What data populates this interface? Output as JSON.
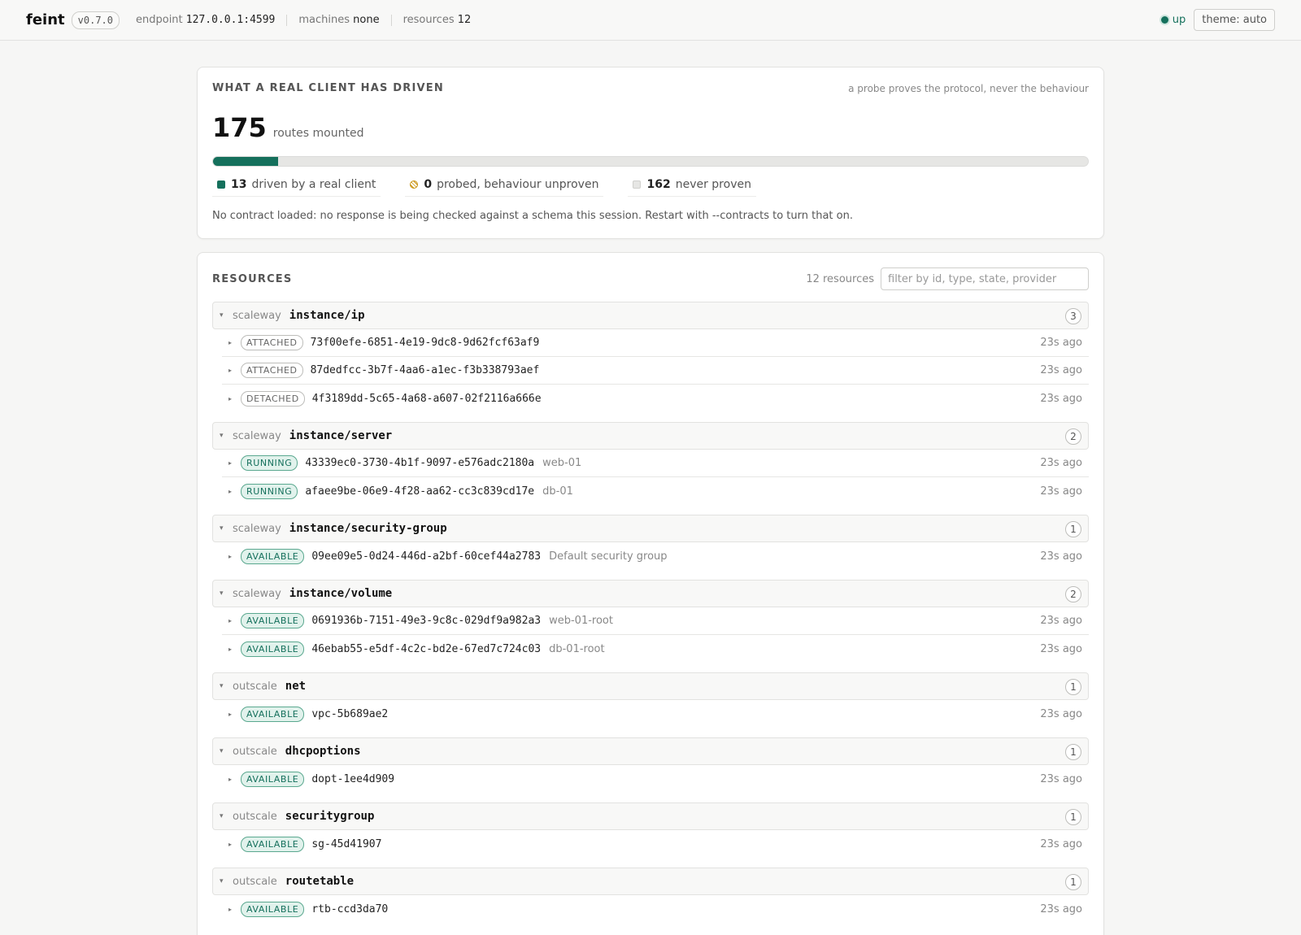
{
  "header": {
    "brand": "feint",
    "version": "v0.7.0",
    "endpoint_label": "endpoint",
    "endpoint_value": "127.0.0.1:4599",
    "machines_label": "machines",
    "machines_value": "none",
    "resources_label": "resources",
    "resources_value": "12",
    "status": "up",
    "theme_label": "theme: auto",
    "status_color": "#15705c"
  },
  "coverage": {
    "title": "WHAT A REAL CLIENT HAS DRIVEN",
    "note": "a probe proves the protocol, never the behaviour",
    "routes": 175,
    "routes_label": "routes mounted",
    "driven": 13,
    "driven_label": "driven by a real client",
    "probed": 0,
    "probed_label": "probed, behaviour unproven",
    "never": 162,
    "never_label": "never proven",
    "contract_note": "No contract loaded: no response is being checked against a schema this session. Restart with --contracts to turn that on."
  },
  "resources": {
    "title": "RESOURCES",
    "count_label": "12 resources",
    "filter_placeholder": "filter by id, type, state, provider",
    "groups": [
      {
        "provider": "scaleway",
        "type": "instance/ip",
        "count": "3",
        "items": [
          {
            "state": "ATTACHED",
            "good": false,
            "id": "73f00efe-6851-4e19-9dc8-9d62fcf63af9",
            "name": "",
            "ago": "23s ago"
          },
          {
            "state": "ATTACHED",
            "good": false,
            "id": "87dedfcc-3b7f-4aa6-a1ec-f3b338793aef",
            "name": "",
            "ago": "23s ago"
          },
          {
            "state": "DETACHED",
            "good": false,
            "id": "4f3189dd-5c65-4a68-a607-02f2116a666e",
            "name": "",
            "ago": "23s ago"
          }
        ]
      },
      {
        "provider": "scaleway",
        "type": "instance/server",
        "count": "2",
        "items": [
          {
            "state": "RUNNING",
            "good": true,
            "id": "43339ec0-3730-4b1f-9097-e576adc2180a",
            "name": "web-01",
            "ago": "23s ago"
          },
          {
            "state": "RUNNING",
            "good": true,
            "id": "afaee9be-06e9-4f28-aa62-cc3c839cd17e",
            "name": "db-01",
            "ago": "23s ago"
          }
        ]
      },
      {
        "provider": "scaleway",
        "type": "instance/security-group",
        "count": "1",
        "items": [
          {
            "state": "AVAILABLE",
            "good": true,
            "id": "09ee09e5-0d24-446d-a2bf-60cef44a2783",
            "name": "Default security group",
            "ago": "23s ago"
          }
        ]
      },
      {
        "provider": "scaleway",
        "type": "instance/volume",
        "count": "2",
        "items": [
          {
            "state": "AVAILABLE",
            "good": true,
            "id": "0691936b-7151-49e3-9c8c-029df9a982a3",
            "name": "web-01-root",
            "ago": "23s ago"
          },
          {
            "state": "AVAILABLE",
            "good": true,
            "id": "46ebab55-e5df-4c2c-bd2e-67ed7c724c03",
            "name": "db-01-root",
            "ago": "23s ago"
          }
        ]
      },
      {
        "provider": "outscale",
        "type": "net",
        "count": "1",
        "items": [
          {
            "state": "AVAILABLE",
            "good": true,
            "id": "vpc-5b689ae2",
            "name": "",
            "ago": "23s ago"
          }
        ]
      },
      {
        "provider": "outscale",
        "type": "dhcpoptions",
        "count": "1",
        "items": [
          {
            "state": "AVAILABLE",
            "good": true,
            "id": "dopt-1ee4d909",
            "name": "",
            "ago": "23s ago"
          }
        ]
      },
      {
        "provider": "outscale",
        "type": "securitygroup",
        "count": "1",
        "items": [
          {
            "state": "AVAILABLE",
            "good": true,
            "id": "sg-45d41907",
            "name": "",
            "ago": "23s ago"
          }
        ]
      },
      {
        "provider": "outscale",
        "type": "routetable",
        "count": "1",
        "items": [
          {
            "state": "AVAILABLE",
            "good": true,
            "id": "rtb-ccd3da70",
            "name": "",
            "ago": "23s ago"
          }
        ]
      }
    ]
  }
}
